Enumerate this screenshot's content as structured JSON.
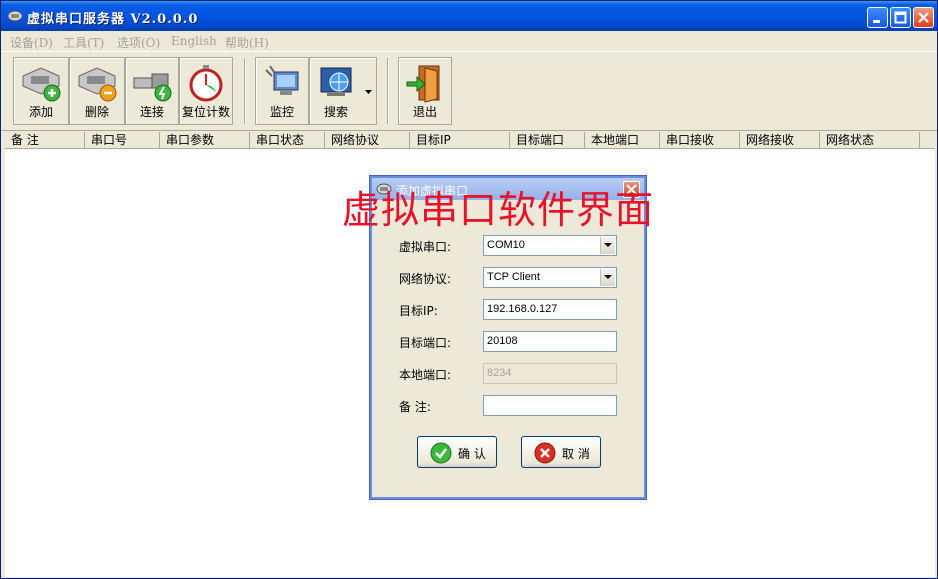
{
  "window": {
    "title": "虚拟串口服务器 V2.0.0.0"
  },
  "menu": [
    {
      "label": "设备(D)"
    },
    {
      "label": "工具(T)"
    },
    {
      "label": "选项(O)"
    },
    {
      "label": "English"
    },
    {
      "label": "帮助(H)"
    }
  ],
  "toolbar": {
    "add": "添加",
    "delete": "删除",
    "connect": "连接",
    "reset": "复位计数",
    "monitor": "监控",
    "search": "搜索",
    "exit": "退出"
  },
  "table": {
    "columns": [
      "备 注",
      "串口号",
      "串口参数",
      "串口状态",
      "网络协议",
      "目标IP",
      "目标端口",
      "本地端口",
      "串口接收",
      "网络接收",
      "网络状态"
    ]
  },
  "dialog": {
    "title": "添加虚拟串口",
    "fields": {
      "vport_label": "虚拟串口:",
      "vport_value": "COM10",
      "protocol_label": "网络协议:",
      "protocol_value": "TCP Client",
      "ip_label": "目标IP:",
      "ip_value": "192.168.0.127",
      "tport_label": "目标端口:",
      "tport_value": "20108",
      "lport_label": "本地端口:",
      "lport_value": "8234",
      "note_label": "备 注:",
      "note_value": ""
    },
    "ok_label": "确 认",
    "cancel_label": "取 消"
  },
  "overlay": {
    "caption": "虚拟串口软件界面"
  },
  "colors": {
    "titlebar": "#0054e3",
    "window_bg": "#ece9d8",
    "caption_red": "#e8132b"
  }
}
